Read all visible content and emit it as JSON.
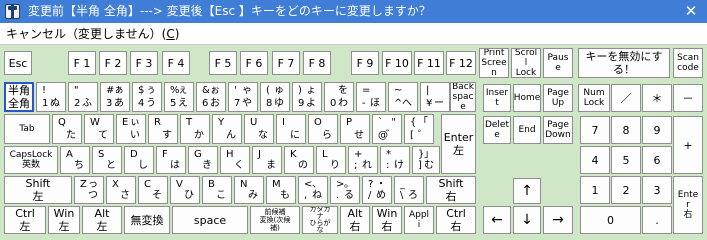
{
  "window": {
    "title": "変更前【半角 全角】---> 変更後【Esc 】キーをどのキーに変更しますか？",
    "close_glyph": "✕"
  },
  "menu": {
    "cancel_label": "キャンセル（変更しません）(",
    "cancel_accel": "C",
    "cancel_close": ")"
  },
  "keys": {
    "esc": "Esc",
    "f1": "F 1",
    "f2": "F 2",
    "f3": "F 3",
    "f4": "F 4",
    "f5": "F 5",
    "f6": "F 6",
    "f7": "F 7",
    "f8": "F 8",
    "f9": "F 9",
    "f10": "F 10",
    "f11": "F 11",
    "f12": "F 12",
    "print_screen": "Print\nScree\nn",
    "scroll_lock": "Scrol\nl\nLock",
    "pause": "Paus\ne",
    "disable": "キーを無効にす\nる！",
    "scan_code": "Scan\ncode",
    "hankaku": "半角\n全角",
    "k1": {
      "tl": "!",
      "bl": "1",
      "br": "ぬ"
    },
    "k2": {
      "tl": "\"",
      "bl": "2",
      "br": "ふ"
    },
    "k3": {
      "tl": "#",
      "tr": "ぁ",
      "bl": "3",
      "br": "あ"
    },
    "k4": {
      "tl": "$",
      "tr": "ぅ",
      "bl": "4",
      "br": "う"
    },
    "k5": {
      "tl": "%",
      "tr": "ぇ",
      "bl": "5",
      "br": "え"
    },
    "k6": {
      "tl": "&",
      "tr": "ぉ",
      "bl": "6",
      "br": "お"
    },
    "k7": {
      "tl": "'",
      "tr": "ゃ",
      "bl": "7",
      "br": "や"
    },
    "k8": {
      "tl": "(",
      "tr": "ゅ",
      "bl": "8",
      "br": "ゆ"
    },
    "k9": {
      "tl": ")",
      "tr": "ょ",
      "bl": "9",
      "br": "よ"
    },
    "k0": {
      "tr": "を",
      "bl": "0",
      "br": "わ"
    },
    "kminus": {
      "tl": "=",
      "bl": "-",
      "br": "ほ"
    },
    "kcaret": {
      "tl": "~",
      "bl": "^",
      "br": "へ"
    },
    "kyen": {
      "tl": "|",
      "bl": "¥",
      "br": "ー"
    },
    "backspace": "Back\nspac\ne",
    "insert": "Inser\nt",
    "home": "Home",
    "pageup": "Page\nUp",
    "numlock": "Num\nLock",
    "np_div": "／",
    "np_mul": "＊",
    "np_sub": "－",
    "tab": "Tab",
    "kq": {
      "tl": "Q",
      "br": "た"
    },
    "kw": {
      "tl": "W",
      "br": "て"
    },
    "ke": {
      "tl": "E",
      "tr": "ぃ",
      "br": "い"
    },
    "kr": {
      "tl": "R",
      "br": "す"
    },
    "kt": {
      "tl": "T",
      "br": "か"
    },
    "ky": {
      "tl": "Y",
      "br": "ん"
    },
    "ku": {
      "tl": "U",
      "br": "な"
    },
    "ki": {
      "tl": "I",
      "br": "に"
    },
    "ko": {
      "tl": "O",
      "br": "ら"
    },
    "kp": {
      "tl": "P",
      "br": "せ"
    },
    "kat": {
      "tl": "`",
      "tr": "\"",
      "bl": "@",
      "br": "゛"
    },
    "kbracket": {
      "tl": "{",
      "tr": "「",
      "bl": "[",
      "br": "゜"
    },
    "enter": "Enter\n左",
    "delete": "Delet\ne",
    "end": "End",
    "pagedown": "Page\nDown",
    "np7": "7",
    "np8": "8",
    "np9": "9",
    "np_add": "+",
    "capslock": "CapsLock\n英数",
    "ka": {
      "tl": "A",
      "br": "ち"
    },
    "ks": {
      "tl": "S",
      "br": "と"
    },
    "kd": {
      "tl": "D",
      "br": "し"
    },
    "kf": {
      "tl": "F",
      "br": "は"
    },
    "kg": {
      "tl": "G",
      "br": "き"
    },
    "kh": {
      "tl": "H",
      "br": "く"
    },
    "kj": {
      "tl": "J",
      "br": "ま"
    },
    "kk": {
      "tl": "K",
      "br": "の"
    },
    "kl": {
      "tl": "L",
      "br": "り"
    },
    "ksemi": {
      "tl": "+",
      "bl": ";",
      "br": "れ"
    },
    "kcolon": {
      "tl": "*",
      "bl": ":",
      "br": "け"
    },
    "kclose": {
      "tl": "}",
      "tr": "」",
      "bl": "]",
      "br": "む"
    },
    "np4": "4",
    "np5": "5",
    "np6": "6",
    "shift_left": "Shift\n左",
    "kz": {
      "tl": "Z",
      "tr": "っ",
      "br": "つ"
    },
    "kx": {
      "tl": "X",
      "br": "さ"
    },
    "kc": {
      "tl": "C",
      "br": "そ"
    },
    "kv": {
      "tl": "V",
      "br": "ひ"
    },
    "kb": {
      "tl": "B",
      "br": "こ"
    },
    "kn": {
      "tl": "N",
      "br": "み"
    },
    "km": {
      "tl": "M",
      "br": "も"
    },
    "kcomma": {
      "tl": "<",
      "tr": "、",
      "bl": ",",
      "br": "ね"
    },
    "kperiod": {
      "tl": ">",
      "tr": "。",
      "bl": ".",
      "br": "る"
    },
    "kslash": {
      "tl": "?",
      "tr": "・",
      "bl": "/",
      "br": "め"
    },
    "kbackslash": {
      "tl": "_",
      "bl": "\\",
      "br": "ろ"
    },
    "shift_right": "Shift\n右",
    "up": "↑",
    "np1": "1",
    "np2": "2",
    "np3": "3",
    "np_enter": "Ente\nr\n右",
    "ctrl_left": "Ctrl\n左",
    "win_left": "Win\n左",
    "alt_left": "Alt\n左",
    "muhenkan": "無変換",
    "space": "space",
    "henkan": "前候補\n変換(次候\n補)",
    "katakana": "カタカ\nナ\nひらが\nな",
    "alt_right": "Alt\n右",
    "win_right": "Win\n右",
    "apps": "Appl\ni",
    "ctrl_right": "Ctrl\n右",
    "left": "←",
    "down": "↓",
    "right": "→",
    "np0": "0",
    "np_dot": "."
  }
}
